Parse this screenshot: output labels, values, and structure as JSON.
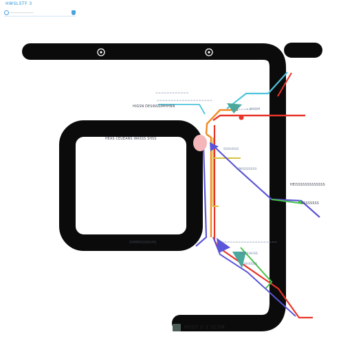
{
  "toolbar": {
    "title": "HWSLSTF 3",
    "search_placeholder": "------------------------"
  },
  "legend": {
    "text": "MSST U 2 SCSM"
  },
  "labels": {
    "top_a": "============",
    "top_b": "====================",
    "left_a": "HIGSN DESINSSIMHHNN",
    "right_a": "• WNBM",
    "left_b": "=======",
    "room_caption": "HEAS CEUEANS WASSS SHSS",
    "mid_a": "SSSHSSS",
    "mid_b": "HMSSSSSSS",
    "right_b": "HEISSSSSSSSSSSSS",
    "right_c": "SSSSSSSS",
    "room_bottom": "SHMMSSNSSHS",
    "low_a": "====================",
    "low_b": "HWSHHSS",
    "low_c": "SHSSSS"
  },
  "colors": {
    "road": "#0b0b0b",
    "red": "#e8352a",
    "orange": "#ef8a24",
    "cyan": "#4ec4dc",
    "yellow": "#d6c33e",
    "indigo": "#5a55d9",
    "green": "#48c04a",
    "teal": "#4aa89c",
    "pink": "#f4b6b8"
  }
}
